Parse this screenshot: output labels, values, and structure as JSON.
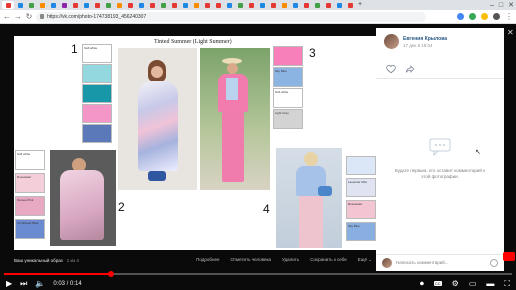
{
  "browser": {
    "url": "https://vk.com/photo-174738193_456240307",
    "tab_favicon_colors": [
      "#e53935",
      "#1e88e5",
      "#43a047",
      "#fb8c00",
      "#1e88e5",
      "#8e24aa",
      "#e53935",
      "#1e88e5",
      "#e53935",
      "#43a047",
      "#fb8c00",
      "#e53935",
      "#1e88e5",
      "#e53935",
      "#43a047",
      "#e53935",
      "#1e88e5",
      "#fb8c00",
      "#e53935",
      "#e53935",
      "#1e88e5",
      "#43a047",
      "#e53935",
      "#1e88e5",
      "#e53935",
      "#fb8c00",
      "#1e88e5",
      "#e53935",
      "#43a047",
      "#e53935",
      "#1e88e5",
      "#e53935"
    ]
  },
  "collage": {
    "title": "Tinted Summer  (Light Summer)",
    "numbers": [
      "1",
      "2",
      "3",
      "4"
    ],
    "swatches_1": [
      {
        "label": "Soft white",
        "color": "#ffffff"
      },
      {
        "label": "",
        "color": "#93d8de"
      },
      {
        "label": "",
        "color": "#1797a8"
      },
      {
        "label": "",
        "color": "#f497c8"
      },
      {
        "label": "",
        "color": "#5b78b9"
      }
    ],
    "swatches_2": [
      {
        "label": "Soft white",
        "color": "#ffffff"
      },
      {
        "label": "Rosewater",
        "color": "#f4cfd9"
      },
      {
        "label": "Cameo Pink",
        "color": "#e7a9c1"
      },
      {
        "label": "Cornflower Blue",
        "color": "#6b8bd0"
      }
    ],
    "swatches_3": [
      {
        "label": "",
        "color": "#f77fba"
      },
      {
        "label": "Sky Blue",
        "color": "#8bb4e3"
      },
      {
        "label": "Soft white",
        "color": "#ffffff"
      },
      {
        "label": "Light Gray",
        "color": "#d3d3d3"
      }
    ],
    "swatches_4": [
      {
        "label": "",
        "color": "#dbe6f6"
      },
      {
        "label": "Lavender Mist",
        "color": "#dfe3f2"
      },
      {
        "label": "Rosewater",
        "color": "#f3c5d2"
      },
      {
        "label": "Sky Blue",
        "color": "#89aee0"
      }
    ]
  },
  "sidebar": {
    "author": "Евгения Крылова",
    "time": "17 дек в 15:04",
    "empty_text": "Будьте первым, кто оставит комментарий к этой фотографии.",
    "comment_placeholder": "Написать комментарий..."
  },
  "footer": {
    "album": "Ваш уникальный образ",
    "count": "1 из 4",
    "actions": [
      "Подробнее",
      "Отметить человека",
      "Удалить",
      "Сохранить к себе",
      "Ещё ⌄"
    ]
  },
  "player": {
    "current_time": "0:03",
    "duration": "0:14",
    "progress_percent": 21,
    "time_sep": " / "
  },
  "colors": {
    "accent": "#ff0000",
    "vk_link": "#2a5885"
  }
}
